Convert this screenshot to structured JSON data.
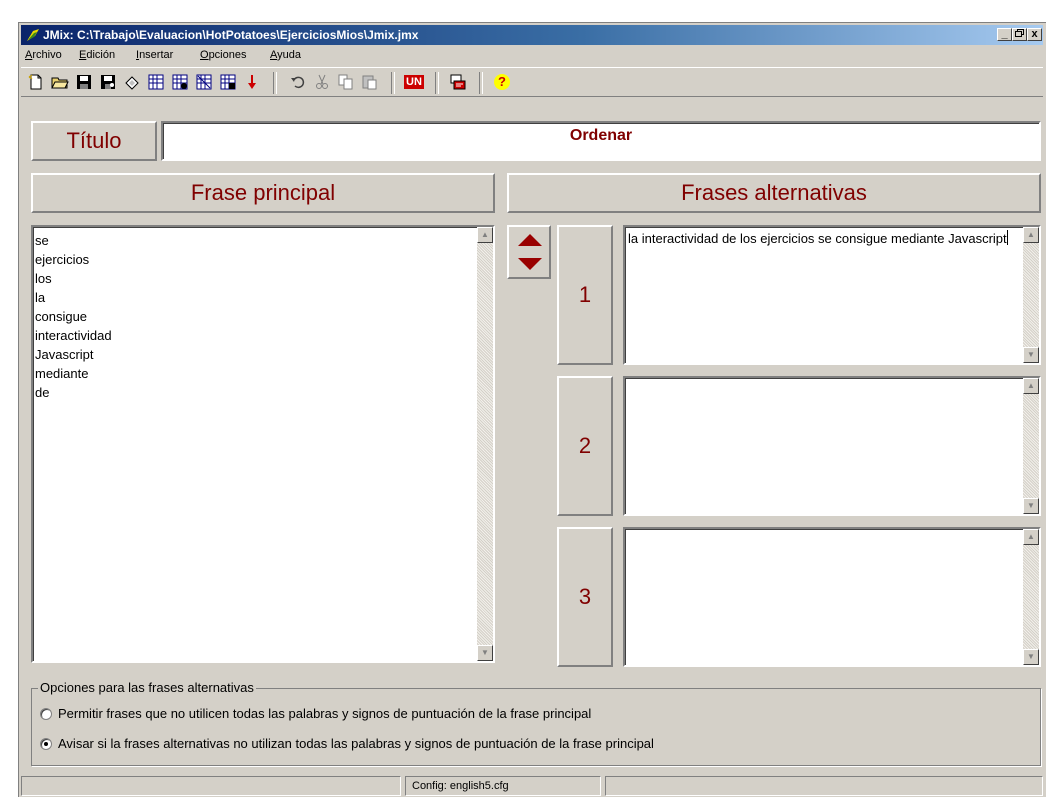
{
  "window": {
    "title": "JMix: C:\\Trabajo\\Evaluacion\\HotPotatoes\\EjerciciosMios\\Jmix.jmx",
    "buttons": [
      "_",
      "🗗",
      "x"
    ]
  },
  "menu": {
    "items": [
      {
        "u": "A",
        "rest": "rchivo"
      },
      {
        "u": "E",
        "rest": "dición"
      },
      {
        "u": "I",
        "rest": "nsertar"
      },
      {
        "u": "O",
        "rest": "pciones"
      },
      {
        "u": "A",
        "rest": "yuda"
      }
    ]
  },
  "toolbar": {
    "icons": [
      "new-file-icon",
      "open-folder-icon",
      "save-icon",
      "save-as-icon",
      "eraser-icon",
      "export-web-icon",
      "export-web-alt-icon",
      "export-web-3-icon",
      "export-web-4-icon",
      "drop-down-arrow-icon",
      "undo-icon",
      "cut-icon",
      "copy-icon",
      "paste-icon",
      "unicode-icon",
      "config-icon",
      "help-icon"
    ],
    "unicode_label": "UN",
    "help_label": "?"
  },
  "title_section": {
    "label": "Título",
    "value": "Ordenar"
  },
  "main_sentence": {
    "header": "Frase principal",
    "words": [
      "se",
      "ejercicios",
      "los",
      "la",
      "consigue",
      "interactividad",
      "Javascript",
      "mediante",
      "de"
    ]
  },
  "alternatives": {
    "header": "Frases alternativas",
    "items": [
      {
        "number": "1",
        "text": "la interactividad de los ejercicios se consigue mediante Javascript"
      },
      {
        "number": "2",
        "text": ""
      },
      {
        "number": "3",
        "text": ""
      }
    ]
  },
  "options": {
    "legend": "Opciones para las frases alternativas",
    "radios": [
      {
        "label": "Permitir frases que no utilicen todas las palabras y signos de puntuación de la frase principal",
        "selected": false
      },
      {
        "label": "Avisar si la frases alternativas no utilizan todas las palabras y signos de puntuación de la frase principal",
        "selected": true
      }
    ]
  },
  "status": {
    "config": "Config: english5.cfg"
  },
  "colors": {
    "accent_text": "#800000",
    "titlebar_start": "#0a246a",
    "face": "#d4d0c8"
  }
}
